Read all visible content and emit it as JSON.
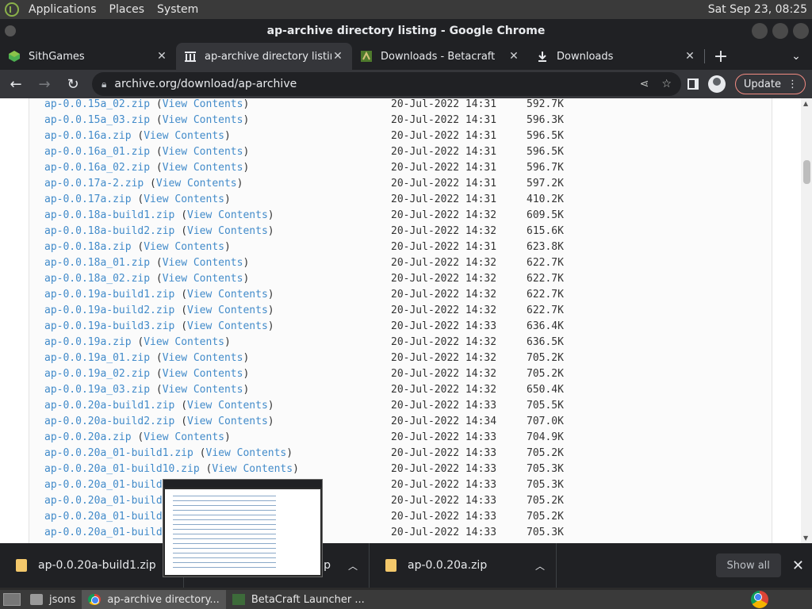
{
  "top_panel": {
    "menus": [
      "Applications",
      "Places",
      "System"
    ],
    "clock": "Sat Sep 23, 08:25"
  },
  "window": {
    "title": "ap-archive directory listing - Google Chrome"
  },
  "tabs": [
    {
      "label": "SithGames",
      "icon": "sithgames-icon",
      "active": false
    },
    {
      "label": "ap-archive directory listing",
      "icon": "archive-org-icon",
      "active": true
    },
    {
      "label": "Downloads - Betacraft",
      "icon": "betacraft-icon",
      "active": false
    },
    {
      "label": "Downloads",
      "icon": "download-icon",
      "active": false
    }
  ],
  "toolbar": {
    "url": "archive.org/download/ap-archive",
    "update_label": "Update"
  },
  "listing": [
    {
      "file": "ap-0.0.15a_02.zip",
      "view": "View Contents",
      "date": "20-Jul-2022 14:31",
      "size": "592.7K"
    },
    {
      "file": "ap-0.0.15a_03.zip",
      "view": "View Contents",
      "date": "20-Jul-2022 14:31",
      "size": "596.3K"
    },
    {
      "file": "ap-0.0.16a.zip",
      "view": "View Contents",
      "date": "20-Jul-2022 14:31",
      "size": "596.5K"
    },
    {
      "file": "ap-0.0.16a_01.zip",
      "view": "View Contents",
      "date": "20-Jul-2022 14:31",
      "size": "596.5K"
    },
    {
      "file": "ap-0.0.16a_02.zip",
      "view": "View Contents",
      "date": "20-Jul-2022 14:31",
      "size": "596.7K"
    },
    {
      "file": "ap-0.0.17a-2.zip",
      "view": "View Contents",
      "date": "20-Jul-2022 14:31",
      "size": "597.2K"
    },
    {
      "file": "ap-0.0.17a.zip",
      "view": "View Contents",
      "date": "20-Jul-2022 14:31",
      "size": "410.2K"
    },
    {
      "file": "ap-0.0.18a-build1.zip",
      "view": "View Contents",
      "date": "20-Jul-2022 14:32",
      "size": "609.5K"
    },
    {
      "file": "ap-0.0.18a-build2.zip",
      "view": "View Contents",
      "date": "20-Jul-2022 14:32",
      "size": "615.6K"
    },
    {
      "file": "ap-0.0.18a.zip",
      "view": "View Contents",
      "date": "20-Jul-2022 14:31",
      "size": "623.8K"
    },
    {
      "file": "ap-0.0.18a_01.zip",
      "view": "View Contents",
      "date": "20-Jul-2022 14:32",
      "size": "622.7K"
    },
    {
      "file": "ap-0.0.18a_02.zip",
      "view": "View Contents",
      "date": "20-Jul-2022 14:32",
      "size": "622.7K"
    },
    {
      "file": "ap-0.0.19a-build1.zip",
      "view": "View Contents",
      "date": "20-Jul-2022 14:32",
      "size": "622.7K"
    },
    {
      "file": "ap-0.0.19a-build2.zip",
      "view": "View Contents",
      "date": "20-Jul-2022 14:32",
      "size": "622.7K"
    },
    {
      "file": "ap-0.0.19a-build3.zip",
      "view": "View Contents",
      "date": "20-Jul-2022 14:33",
      "size": "636.4K"
    },
    {
      "file": "ap-0.0.19a.zip",
      "view": "View Contents",
      "date": "20-Jul-2022 14:32",
      "size": "636.5K"
    },
    {
      "file": "ap-0.0.19a_01.zip",
      "view": "View Contents",
      "date": "20-Jul-2022 14:32",
      "size": "705.2K"
    },
    {
      "file": "ap-0.0.19a_02.zip",
      "view": "View Contents",
      "date": "20-Jul-2022 14:32",
      "size": "705.2K"
    },
    {
      "file": "ap-0.0.19a_03.zip",
      "view": "View Contents",
      "date": "20-Jul-2022 14:32",
      "size": "650.4K"
    },
    {
      "file": "ap-0.0.20a-build1.zip",
      "view": "View Contents",
      "date": "20-Jul-2022 14:33",
      "size": "705.5K"
    },
    {
      "file": "ap-0.0.20a-build2.zip",
      "view": "View Contents",
      "date": "20-Jul-2022 14:34",
      "size": "707.0K"
    },
    {
      "file": "ap-0.0.20a.zip",
      "view": "View Contents",
      "date": "20-Jul-2022 14:33",
      "size": "704.9K"
    },
    {
      "file": "ap-0.0.20a_01-build1.zip",
      "view": "View Contents",
      "date": "20-Jul-2022 14:33",
      "size": "705.2K"
    },
    {
      "file": "ap-0.0.20a_01-build10.zip",
      "view": "View Contents",
      "date": "20-Jul-2022 14:33",
      "size": "705.3K"
    },
    {
      "file": "ap-0.0.20a_01-build",
      "view": "",
      "date": "20-Jul-2022 14:33",
      "size": "705.3K"
    },
    {
      "file": "ap-0.0.20a_01-build",
      "view": "",
      "date": "20-Jul-2022 14:33",
      "size": "705.2K"
    },
    {
      "file": "ap-0.0.20a_01-build",
      "view": "",
      "date": "20-Jul-2022 14:33",
      "size": "705.2K"
    },
    {
      "file": "ap-0.0.20a_01-build",
      "view": "",
      "date": "20-Jul-2022 14:33",
      "size": "705.3K"
    }
  ],
  "downloads": [
    {
      "name": "ap-0.0.20a-build1.zip"
    },
    {
      "name": "ip"
    },
    {
      "name": "ap-0.0.20a.zip"
    }
  ],
  "download_bar": {
    "show_all": "Show all"
  },
  "taskbar": [
    {
      "label": "jsons",
      "icon": "folder-icon"
    },
    {
      "label": "ap-archive directory...",
      "icon": "chrome-icon",
      "active": true
    },
    {
      "label": "BetaCraft Launcher ...",
      "icon": "betacraft-icon"
    }
  ]
}
